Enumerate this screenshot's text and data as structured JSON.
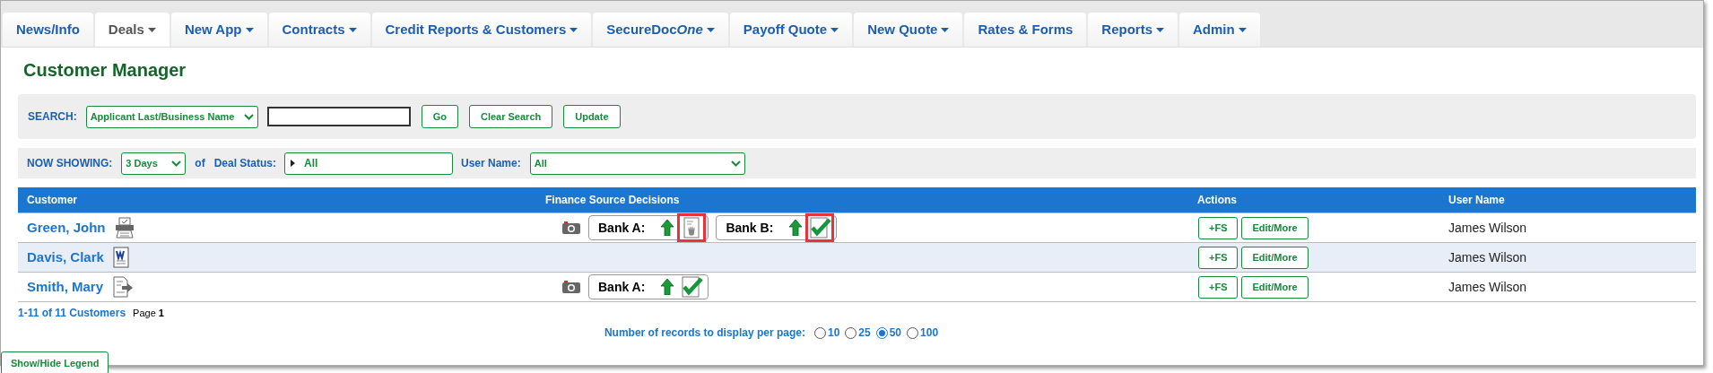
{
  "tabs": [
    {
      "label": "News/Info",
      "selected": false,
      "menu": false
    },
    {
      "label": "Deals",
      "selected": true,
      "menu": true
    },
    {
      "label": "New App",
      "selected": false,
      "menu": true
    },
    {
      "label": "Contracts",
      "selected": false,
      "menu": true
    },
    {
      "label": "Credit Reports & Customers",
      "selected": false,
      "menu": true
    },
    {
      "label": "SecureDoc",
      "italic_suffix": "One",
      "selected": false,
      "menu": true
    },
    {
      "label": "Payoff Quote",
      "selected": false,
      "menu": true
    },
    {
      "label": "New Quote",
      "selected": false,
      "menu": true
    },
    {
      "label": "Rates & Forms",
      "selected": false,
      "menu": false
    },
    {
      "label": "Reports",
      "selected": false,
      "menu": true
    },
    {
      "label": "Admin",
      "selected": false,
      "menu": true
    }
  ],
  "title": "Customer Manager",
  "search": {
    "label": "SEARCH:",
    "field_select": "Applicant Last/Business Name",
    "buttons": [
      "Go",
      "Clear Search",
      "Update"
    ]
  },
  "filters": {
    "label": "NOW SHOWING:",
    "period": "3 Days",
    "of": "of",
    "status_label": "Deal Status:",
    "status": "All",
    "user_label": "User Name:",
    "user": "All"
  },
  "table": {
    "columns": [
      "Customer",
      "Finance Source Decisions",
      "Actions",
      "User Name"
    ],
    "rows": [
      {
        "customer": "Green, John",
        "kind": "print",
        "camera": true,
        "decisions": [
          {
            "bank": "Bank A:",
            "kind": "trash",
            "highlighted": true
          },
          {
            "bank": "Bank B:",
            "kind": "check",
            "highlighted": true
          }
        ],
        "actions": [
          "+FS",
          "Edit/More"
        ],
        "user": "James Wilson"
      },
      {
        "customer": "Davis, Clark",
        "kind": "word",
        "camera": false,
        "decisions": [],
        "actions": [
          "+FS",
          "Edit/More"
        ],
        "user": "James Wilson"
      },
      {
        "customer": "Smith, Mary",
        "kind": "export",
        "camera": true,
        "decisions": [
          {
            "bank": "Bank A:",
            "kind": "check",
            "highlighted": false
          }
        ],
        "actions": [
          "+FS",
          "Edit/More"
        ],
        "user": "James Wilson"
      }
    ]
  },
  "count": "1-11 of 11 Customers",
  "page": "Page **1**",
  "per_page": {
    "label": "Number of records to display per page:",
    "options": [
      {
        "label": "10",
        "selected": false
      },
      {
        "label": "25",
        "selected": false
      },
      {
        "label": "50",
        "selected": true
      },
      {
        "label": "100",
        "selected": false
      }
    ]
  },
  "legend_button": "Show/Hide Legend"
}
